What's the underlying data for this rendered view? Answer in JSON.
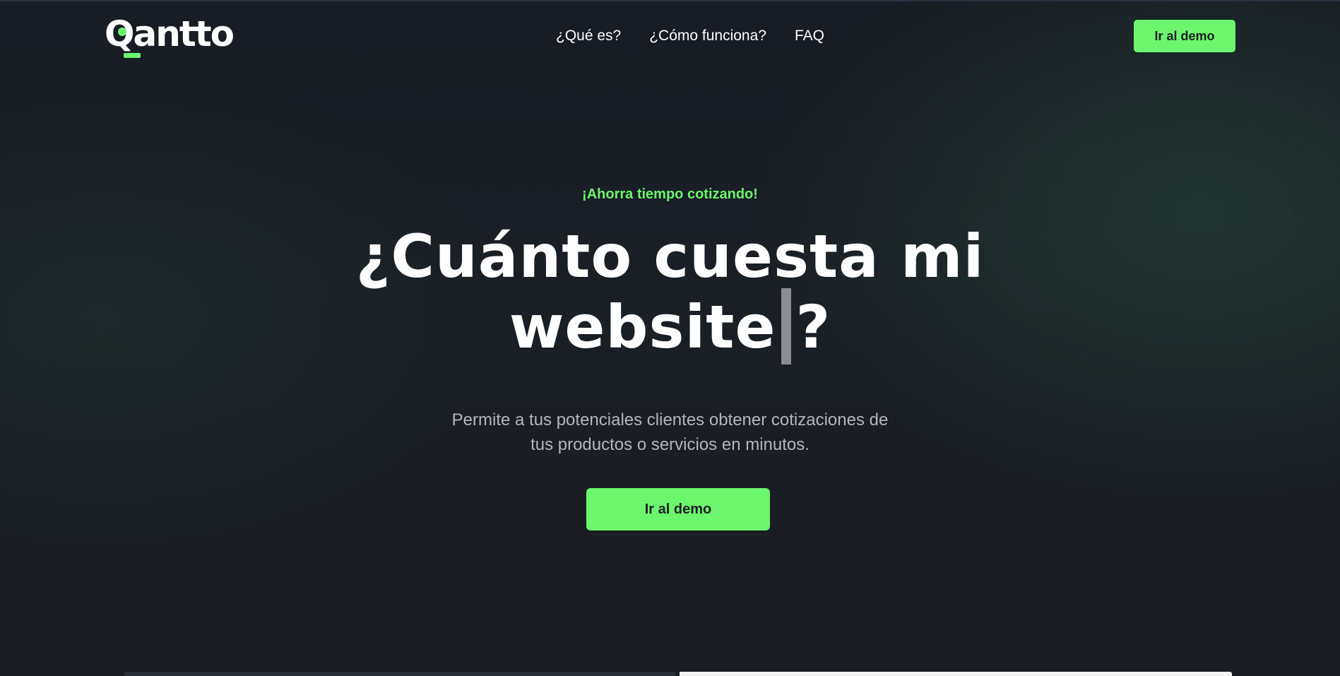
{
  "brand": {
    "name": "Qantto",
    "accent_color": "#6cf66e"
  },
  "nav": {
    "items": [
      {
        "label": "¿Qué es?"
      },
      {
        "label": "¿Cómo funciona?"
      },
      {
        "label": "FAQ"
      }
    ],
    "cta_label": "Ir al demo"
  },
  "hero": {
    "eyebrow": "¡Ahorra tiempo cotizando!",
    "headline_line1": "¿Cuánto cuesta mi",
    "headline_word": "website",
    "headline_end": "?",
    "subtitle_line1": "Permite a tus potenciales clientes obtener cotizaciones de",
    "subtitle_line2": "tus productos o servicios en minutos.",
    "cta_label": "Ir al demo"
  }
}
